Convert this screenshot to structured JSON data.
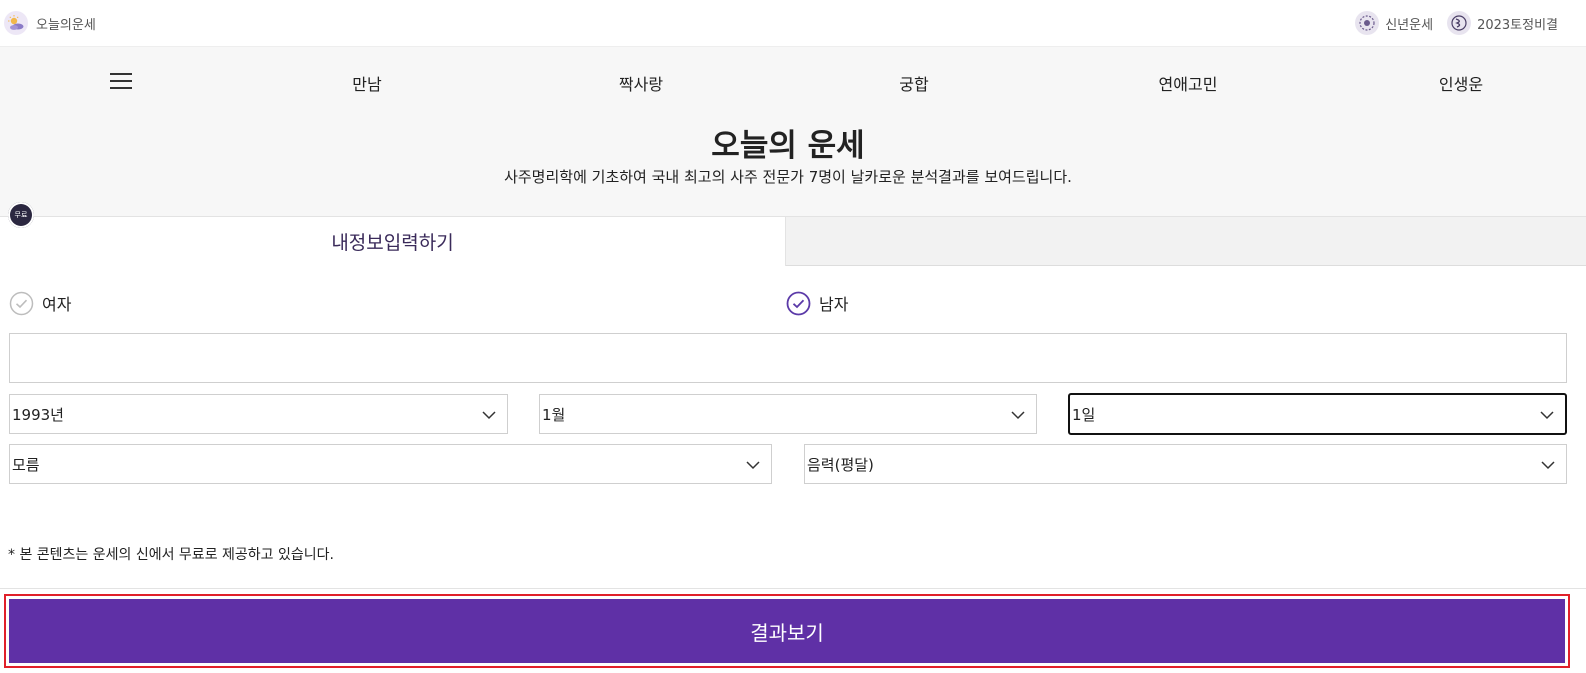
{
  "topbar": {
    "logo_text": "오늘의운세",
    "links": [
      {
        "label": "신년운세",
        "icon": "newyear-seal-icon"
      },
      {
        "label": "2023토정비결",
        "icon": "tojeong-seal-icon"
      }
    ]
  },
  "nav": {
    "items": [
      "만남",
      "짝사랑",
      "궁합",
      "연애고민",
      "인생운"
    ]
  },
  "hero": {
    "title": "오늘의 운세",
    "subtitle": "사주명리학에 기초하여 국내 최고의 사주 전문가 7명이 날카로운 분석결과를 보여드립니다."
  },
  "badge": {
    "label": "무료"
  },
  "tabs": {
    "active_label": "내정보입력하기",
    "inactive_label": ""
  },
  "gender": {
    "options": [
      {
        "label": "여자",
        "selected": false
      },
      {
        "label": "남자",
        "selected": true
      }
    ]
  },
  "form": {
    "name_value": "",
    "year": "1993년",
    "month": "1월",
    "day": "1일",
    "birth_time": "모름",
    "calendar": "음력(평달)"
  },
  "notice": "* 본 콘텐츠는 운세의 신에서 무료로 제공하고 있습니다.",
  "result_button_label": "결과보기",
  "colors": {
    "accent": "#5f30a6",
    "highlight_border": "#e0202a",
    "radio_selected": "#5b3aa8",
    "radio_unselected": "#bdbdbd"
  }
}
